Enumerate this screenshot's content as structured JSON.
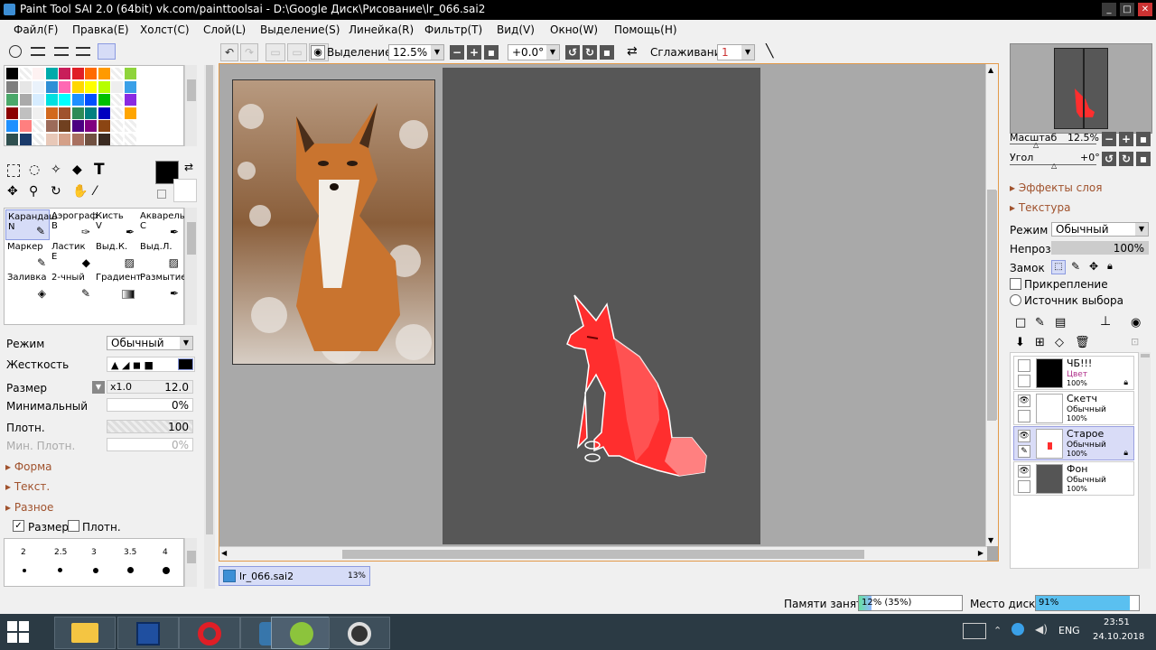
{
  "title": "Paint Tool SAI 2.0 (64bit) vk.com/painttoolsai - D:\\Google Диск\\Рисование\\lr_066.sai2",
  "window_controls": [
    "_",
    "□",
    "✕"
  ],
  "menu": [
    "Файл(F)",
    "Правка(E)",
    "Холст(C)",
    "Слой(L)",
    "Выделение(S)",
    "Линейка(R)",
    "Фильтр(T)",
    "Вид(V)",
    "Окно(W)",
    "Помощь(H)"
  ],
  "toolbar": {
    "selection_label": "Выделение",
    "zoom": "12.5%",
    "rotation": "+0.0°",
    "smoothing_label": "Сглаживание",
    "smoothing": "1"
  },
  "brush_tools": [
    {
      "name": "Карандаш",
      "key": "N",
      "icon": "pencil-icon",
      "active": true
    },
    {
      "name": "Аэрограф",
      "key": "B",
      "icon": "airbrush-icon"
    },
    {
      "name": "Кисть",
      "key": "V",
      "icon": "brush-icon"
    },
    {
      "name": "Акварель",
      "key": "C",
      "icon": "watercolor-icon"
    },
    {
      "name": "Маркер",
      "key": "",
      "icon": "marker-icon"
    },
    {
      "name": "Ластик",
      "key": "E",
      "icon": "eraser-icon"
    },
    {
      "name": "Выд.К.",
      "key": "",
      "icon": "select-pen-icon"
    },
    {
      "name": "Выд.Л.",
      "key": "",
      "icon": "select-eraser-icon"
    },
    {
      "name": "Заливка",
      "key": "",
      "icon": "bucket-icon"
    },
    {
      "name": "2-чный",
      "key": "",
      "icon": "binary-pen-icon"
    },
    {
      "name": "Градиент",
      "key": "",
      "icon": "gradient-icon"
    },
    {
      "name": "Размытие",
      "key": "",
      "icon": "blur-icon"
    }
  ],
  "tool_settings": {
    "mode_label": "Режим",
    "mode_value": "Обычный",
    "hardness_label": "Жесткость",
    "size_label": "Размер",
    "size_multiplier": "x1.0",
    "size_value": "12.0",
    "min_label": "Минимальный",
    "min_value": "0%",
    "density_label": "Плотн.",
    "density_value": "100",
    "min_density_label": "Мин. Плотн.",
    "min_density_value": "0%",
    "sections": [
      "Форма",
      "Текст.",
      "Разное"
    ],
    "check_size": "Размер",
    "check_density": "Плотн.",
    "brush_sizes": [
      "2",
      "2.5",
      "3",
      "3.5",
      "4"
    ]
  },
  "document_tab": {
    "name": "lr_066.sai2",
    "zoom": "13%"
  },
  "navigator": {
    "scale_label": "Масштаб",
    "scale_value": "12.5%",
    "angle_label": "Угол",
    "angle_value": "+0°"
  },
  "layer_panel": {
    "effects_label": "Эффекты слоя",
    "texture_label": "Текстура",
    "mode_label": "Режим",
    "mode_value": "Обычный",
    "opacity_label": "Непроз.",
    "opacity_value": "100%",
    "lock_label": "Замок",
    "clip_label": "Прикрепление",
    "source_label": "Источник выбора"
  },
  "layers": [
    {
      "name": "ЧБ!!!",
      "mode": "Цвет",
      "opacity": "100%",
      "visible": false,
      "thumb": "#000000",
      "locked": true
    },
    {
      "name": "Скетч",
      "mode": "Обычный",
      "opacity": "100%",
      "visible": true,
      "thumb": "#ffffff",
      "locked": false
    },
    {
      "name": "Старое",
      "mode": "Обычный",
      "opacity": "100%",
      "visible": true,
      "thumb": "#ffffff",
      "locked": true,
      "active": true
    },
    {
      "name": "Фон",
      "mode": "Обычный",
      "opacity": "100%",
      "visible": true,
      "thumb": "#555555",
      "locked": false
    }
  ],
  "status": {
    "memory_label": "Памяти занято",
    "memory_value": "12% (35%)",
    "memory_fraction": 0.12,
    "disk_label": "Место диска",
    "disk_value": "91%",
    "disk_fraction": 0.91
  },
  "taskbar": {
    "apps": [
      "start-icon",
      "explorer-icon",
      "save-icon",
      "opera-icon",
      "python-icon",
      "sai-icon",
      "obs-icon"
    ],
    "lang": "ENG",
    "time": "23:51",
    "date": "24.10.2018"
  },
  "colors": {
    "accent_red": "#ff2e2e",
    "canvas_gray": "#575757",
    "workspace": "#a9a9a9",
    "section_text": "#a0522d"
  }
}
